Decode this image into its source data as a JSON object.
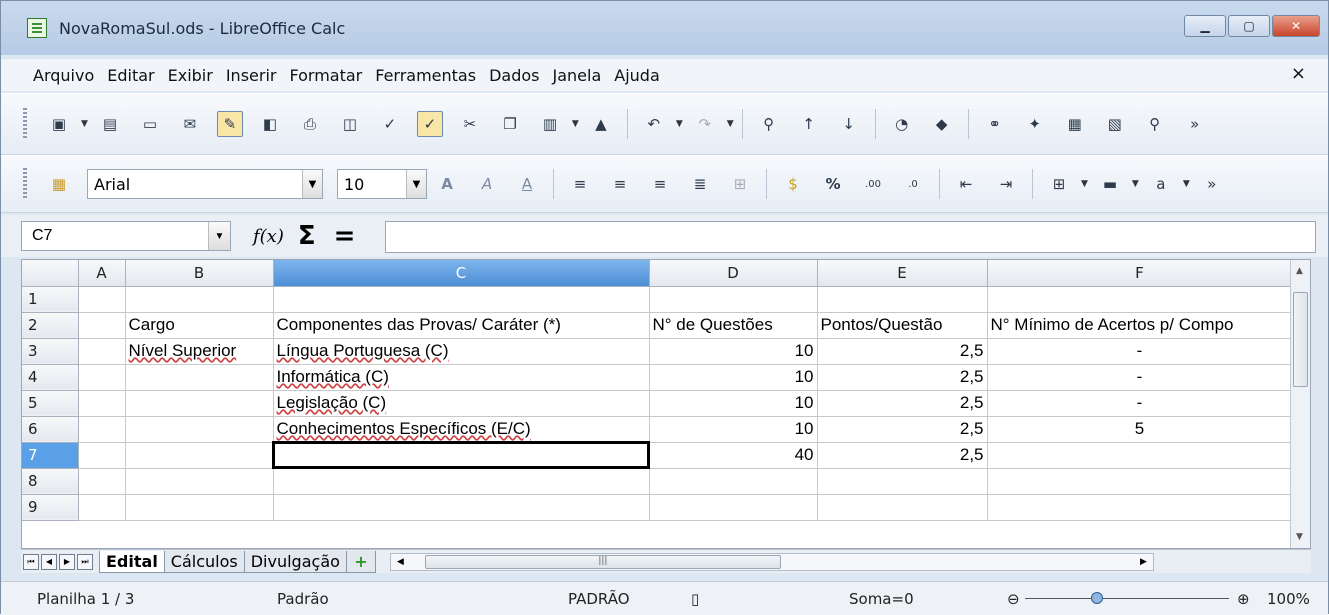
{
  "window": {
    "title": "NovaRomaSul.ods - LibreOffice Calc",
    "minimize": "▁",
    "maximize": "▢",
    "close": "✕"
  },
  "menu": {
    "items": [
      "Arquivo",
      "Editar",
      "Exibir",
      "Inserir",
      "Formatar",
      "Ferramentas",
      "Dados",
      "Janela",
      "Ajuda"
    ],
    "close": "×"
  },
  "toolbar2": {
    "font_name": "Arial",
    "font_size": "10"
  },
  "formula": {
    "name_box": "C7",
    "fx": "f(x)",
    "sigma": "Σ",
    "equals": "=",
    "content": ""
  },
  "grid": {
    "columns": [
      "A",
      "B",
      "C",
      "D",
      "E",
      "F"
    ],
    "selected_column": "C",
    "selected_row": "7",
    "rows": [
      {
        "n": "1",
        "A": "",
        "B": "",
        "C": "",
        "D": "",
        "E": "",
        "F": ""
      },
      {
        "n": "2",
        "A": "",
        "B": "Cargo",
        "C": "Componentes das Provas/ Caráter (*)",
        "D": "N° de Questões",
        "E": "Pontos/Questão",
        "F": "N° Mínimo de Acertos p/ Compo"
      },
      {
        "n": "3",
        "A": "",
        "B": "Nível Superior",
        "C": "Língua Portuguesa (C)",
        "D": "10",
        "E": "2,5",
        "F": "-"
      },
      {
        "n": "4",
        "A": "",
        "B": "",
        "C": "Informática (C)",
        "D": "10",
        "E": "2,5",
        "F": "-"
      },
      {
        "n": "5",
        "A": "",
        "B": "",
        "C": "Legislação (C)",
        "D": "10",
        "E": "2,5",
        "F": "-"
      },
      {
        "n": "6",
        "A": "",
        "B": "",
        "C": "Conhecimentos Específicos (E/C)",
        "D": "10",
        "E": "2,5",
        "F": "5"
      },
      {
        "n": "7",
        "A": "",
        "B": "",
        "C": "",
        "D": "40",
        "E": "2,5",
        "F": ""
      },
      {
        "n": "8",
        "A": "",
        "B": "",
        "C": "",
        "D": "",
        "E": "",
        "F": ""
      },
      {
        "n": "9",
        "A": "",
        "B": "",
        "C": "",
        "D": "",
        "E": "",
        "F": ""
      }
    ]
  },
  "sheets": {
    "tabs": [
      "Edital",
      "Cálculos",
      "Divulgação"
    ],
    "active": "Edital",
    "add": "+"
  },
  "status": {
    "sheet": "Planilha 1 / 3",
    "style": "Padrão",
    "mode": "PADRÃO",
    "sum": "Soma=0",
    "zoom": "100%",
    "zoom_level": 1.0
  }
}
